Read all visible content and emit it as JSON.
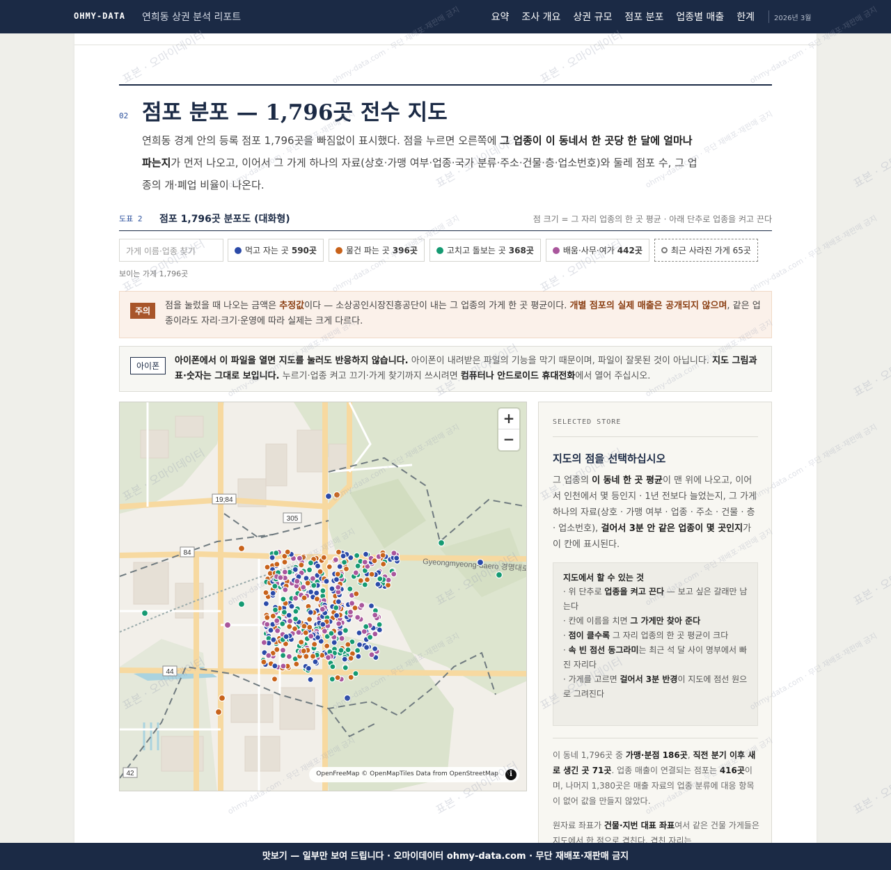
{
  "nav": {
    "brand": "OHMY-DATA",
    "report_title": "연희동 상권 분석 리포트",
    "links": [
      "요약",
      "조사 개요",
      "상권 규모",
      "점포 분포",
      "업종별 매출",
      "한계"
    ],
    "date": "2026년 3월"
  },
  "section": {
    "number": "02",
    "title": "점포 분포 — 1,796곳 전수 지도",
    "intro_1": "연희동 경계 안의 등록 점포 1,796곳을 빠짐없이 표시했다. 점을 누르면 오른쪽에 ",
    "intro_bold": "그 업종이 이 동네서 한 곳당 한 달에 얼마나 파는지",
    "intro_2": "가 먼저 나오고, 이어서 그 가게 하나의 자료(상호·가맹 여부·업종·국가 분류·주소·건물·층·업소번호)와 둘레 점포 수, 그 업종의 개·폐업 비율이 나온다."
  },
  "figure": {
    "label": "도표 2",
    "title": "점포 1,796곳 분포도 (대화형)",
    "note": "점 크기 = 그 자리 업종의 한 곳 평균 · 아래 단추로 업종을 켜고 끈다"
  },
  "search": {
    "placeholder": "가게 이름·업종 찾기"
  },
  "filters": [
    {
      "label": "먹고 자는 곳",
      "count": "590곳",
      "color": "#2b4aa8"
    },
    {
      "label": "물건 파는 곳",
      "count": "396곳",
      "color": "#c8621a"
    },
    {
      "label": "고치고 돌보는 곳",
      "count": "368곳",
      "color": "#159a72"
    },
    {
      "label": "배움·사무·여가",
      "count": "442곳",
      "color": "#a9569c"
    },
    {
      "label": "최근 사라진 가게",
      "count": "65곳",
      "color": "#777777"
    }
  ],
  "visible_count": "보이는 가게 1,796곳",
  "caution": {
    "tag": "주의",
    "t1": "점을 눌렀을 때 나오는 금액은 ",
    "b1": "추정값",
    "t2": "이다 — 소상공인시장진흥공단이 내는 그 업종의 가게 한 곳 평균이다. ",
    "b2": "개별 점포의 실제 매출은 공개되지 않으며",
    "t3": ", 같은 업종이라도 자리·크기·운영에 따라 실제는 크게 다르다."
  },
  "iphone": {
    "tag": "아이폰",
    "b1": "아이폰에서 이 파일을 열면 지도를 눌러도 반응하지 않습니다.",
    "t1": " 아이폰이 내려받은 파일의 기능을 막기 때문이며, 파일이 잘못된 것이 아닙니다. ",
    "b2": "지도 그림과 표·숫자는 그대로 보입니다.",
    "t2": " 누르기·업종 켜고 끄기·가게 찾기까지 쓰시려면 ",
    "b3": "컴퓨터나 안드로이드 휴대전화",
    "t3": "에서 열어 주십시오."
  },
  "map": {
    "zoom_in": "+",
    "zoom_out": "−",
    "attribution": "OpenFreeMap © OpenMapTiles Data from OpenStreetMap",
    "info": "i",
    "road_label": "Gyeongmyeong-daero 경명대로",
    "shields": [
      "19;84",
      "305",
      "84",
      "44",
      "42"
    ]
  },
  "panel": {
    "eyebrow": "SELECTED STORE",
    "title": "지도의 점을 선택하십시오",
    "d1": "그 업종의 ",
    "d1b": "이 동네 한 곳 평균",
    "d2": "이 맨 위에 나오고, 이어서 인천에서 몇 등인지 · 1년 전보다 늘었는지, 그 가게 하나의 자료(상호 · 가맹 여부 · 업종 · 주소 · 건물 · 층 · 업소번호), ",
    "d2b": "걸어서 3분 안 같은 업종이 몇 곳인지",
    "d3": "가 이 칸에 표시된다.",
    "box_title": "지도에서 할 수 있는 것",
    "box_items": [
      {
        "pre": "· 위 단추로 ",
        "b": "업종을 켜고 끈다",
        "post": " — 보고 싶은 갈래만 남는다"
      },
      {
        "pre": "· 칸에 이름을 치면 ",
        "b": "그 가게만 찾아 준다",
        "post": ""
      },
      {
        "pre": "· ",
        "b": "점이 클수록",
        "post": " 그 자리 업종의 한 곳 평균이 크다"
      },
      {
        "pre": "· ",
        "b": "속 빈 점선 동그라미",
        "post": "는 최근 석 달 사이 명부에서 빠진 자리다"
      },
      {
        "pre": "· 가게를 고르면 ",
        "b": "걸어서 3분 반경",
        "post": "이 지도에 점선 원으로 그려진다"
      }
    ],
    "s1": "이 동네 1,796곳 중 ",
    "s1b": "가맹·분점 186곳",
    "s2": ", ",
    "s2b": "직전 분기 이후 새로 생긴 곳 71곳",
    "s3": ". 업종 매출이 연결되는 점포는 ",
    "s3b": "416곳",
    "s4": "이며, 나머지 1,380곳은 매출 자료의 업종 분류에 대응 항목이 없어 값을 만들지 않았다.",
    "c1": "원자료 좌표가 ",
    "c1b": "건물·지번 대표 좌표",
    "c2": "여서 같은 건물 가게들은 지도에서 한 점으로 겹친다. 겹친 자리는"
  },
  "watermark": [
    "표본 · 오마이데이터",
    "ohmy-data.com · 무단 재배포·재판매 금지"
  ],
  "footer": "맛보기 — 일부만 보여 드립니다 · 오마이데이터 ohmy-data.com · 무단 재배포·재판매 금지"
}
